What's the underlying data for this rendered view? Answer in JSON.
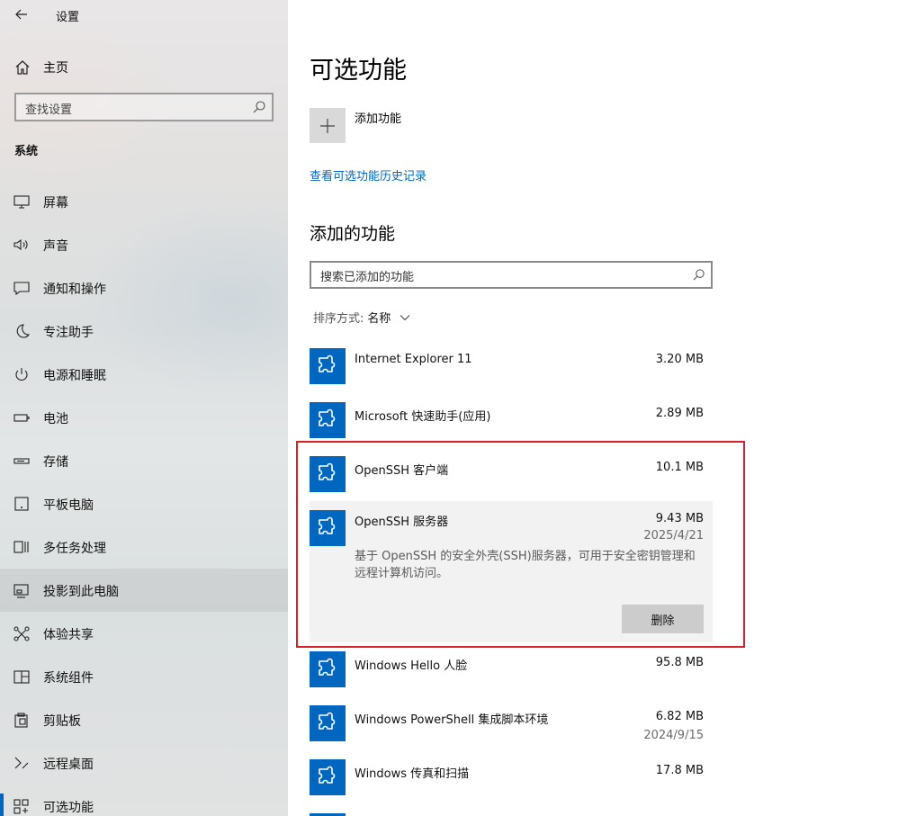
{
  "window": {
    "title": "设置"
  },
  "sidebar": {
    "home_label": "主页",
    "search_placeholder": "查找设置",
    "section_label": "系统",
    "items": [
      {
        "label": "屏幕",
        "icon": "monitor-icon"
      },
      {
        "label": "声音",
        "icon": "speaker-icon"
      },
      {
        "label": "通知和操作",
        "icon": "notification-icon"
      },
      {
        "label": "专注助手",
        "icon": "moon-icon"
      },
      {
        "label": "电源和睡眠",
        "icon": "power-icon"
      },
      {
        "label": "电池",
        "icon": "battery-icon"
      },
      {
        "label": "存储",
        "icon": "storage-icon"
      },
      {
        "label": "平板电脑",
        "icon": "tablet-icon"
      },
      {
        "label": "多任务处理",
        "icon": "multitask-icon"
      },
      {
        "label": "投影到此电脑",
        "icon": "projector-icon"
      },
      {
        "label": "体验共享",
        "icon": "share-icon"
      },
      {
        "label": "系统组件",
        "icon": "components-icon"
      },
      {
        "label": "剪贴板",
        "icon": "clipboard-icon"
      },
      {
        "label": "远程桌面",
        "icon": "remote-icon"
      },
      {
        "label": "可选功能",
        "icon": "optional-features-icon"
      }
    ],
    "hovered_index": 9,
    "selected_index": 14
  },
  "main": {
    "title": "可选功能",
    "add_feature_label": "添加功能",
    "history_link": "查看可选功能历史记录",
    "added_title": "添加的功能",
    "search_placeholder": "搜索已添加的功能",
    "sort_label": "排序方式:",
    "sort_value": "名称",
    "features": [
      {
        "name": "Internet Explorer 11",
        "size": "3.20 MB"
      },
      {
        "name": "Microsoft 快速助手(应用)",
        "size": "2.89 MB"
      },
      {
        "name": "OpenSSH 客户端",
        "size": "10.1 MB"
      }
    ],
    "expanded_feature": {
      "name": "OpenSSH 服务器",
      "size": "9.43 MB",
      "date": "2025/4/21",
      "description": "基于 OpenSSH 的安全外壳(SSH)服务器，可用于安全密钥管理和远程计算机访问。",
      "remove_label": "删除"
    },
    "features_after": [
      {
        "name": "Windows Hello 人脸",
        "size": "95.8 MB"
      },
      {
        "name": "Windows PowerShell 集成脚本环境",
        "size": "6.82 MB",
        "date": "2024/9/15"
      },
      {
        "name": "Windows 传真和扫描",
        "size": "17.8 MB"
      }
    ]
  },
  "colors": {
    "accent": "#0067c0",
    "highlight_box": "#d9202a",
    "tile_gray": "#d9d9d9"
  }
}
